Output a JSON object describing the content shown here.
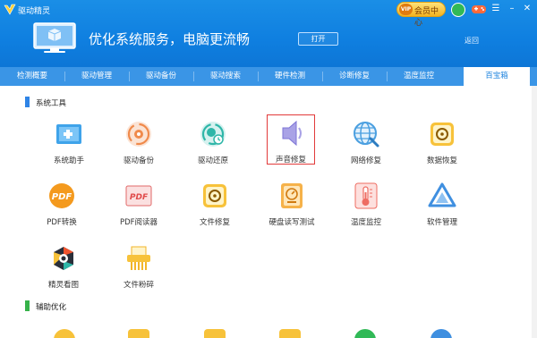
{
  "app": {
    "name": "驱动精灵",
    "vip_badge": "VIP",
    "vip_label": "会员中心"
  },
  "window_controls": {
    "menu": "☰",
    "minimize": "–",
    "close": "✕"
  },
  "banner": {
    "slogan": "优化系统服务，电脑更流畅",
    "open_button": "打开",
    "back": "返回"
  },
  "nav": [
    {
      "label": "检测概要"
    },
    {
      "label": "驱动管理"
    },
    {
      "label": "驱动备份"
    },
    {
      "label": "驱动搜索"
    },
    {
      "label": "硬件检测"
    },
    {
      "label": "诊断修复"
    },
    {
      "label": "温度监控"
    },
    {
      "label": "百宝箱",
      "active": true
    }
  ],
  "sections": [
    {
      "title": "系统工具",
      "tools": [
        {
          "label": "系统助手",
          "icon": "system-assistant-icon"
        },
        {
          "label": "驱动备份",
          "icon": "driver-backup-icon"
        },
        {
          "label": "驱动还原",
          "icon": "driver-restore-icon"
        },
        {
          "label": "声音修复",
          "icon": "sound-repair-icon",
          "selected": true
        },
        {
          "label": "网络修复",
          "icon": "network-repair-icon"
        },
        {
          "label": "数据恢复",
          "icon": "data-recovery-icon"
        },
        {
          "label": "PDF转换",
          "icon": "pdf-convert-icon"
        },
        {
          "label": "PDF阅读器",
          "icon": "pdf-reader-icon"
        },
        {
          "label": "文件修复",
          "icon": "file-repair-icon"
        },
        {
          "label": "硬盘读写测试",
          "icon": "disk-test-icon"
        },
        {
          "label": "温度监控",
          "icon": "thermometer-icon"
        },
        {
          "label": "软件管理",
          "icon": "software-manager-icon"
        },
        {
          "label": "精灵看图",
          "icon": "image-viewer-icon"
        },
        {
          "label": "文件粉碎",
          "icon": "file-shredder-icon"
        }
      ]
    },
    {
      "title": "辅助优化"
    }
  ],
  "colors": {
    "header": "#1a8ee6",
    "nav": "#3a95e6",
    "accent": "#2f84e6",
    "selected_border": "#e23a3a"
  }
}
